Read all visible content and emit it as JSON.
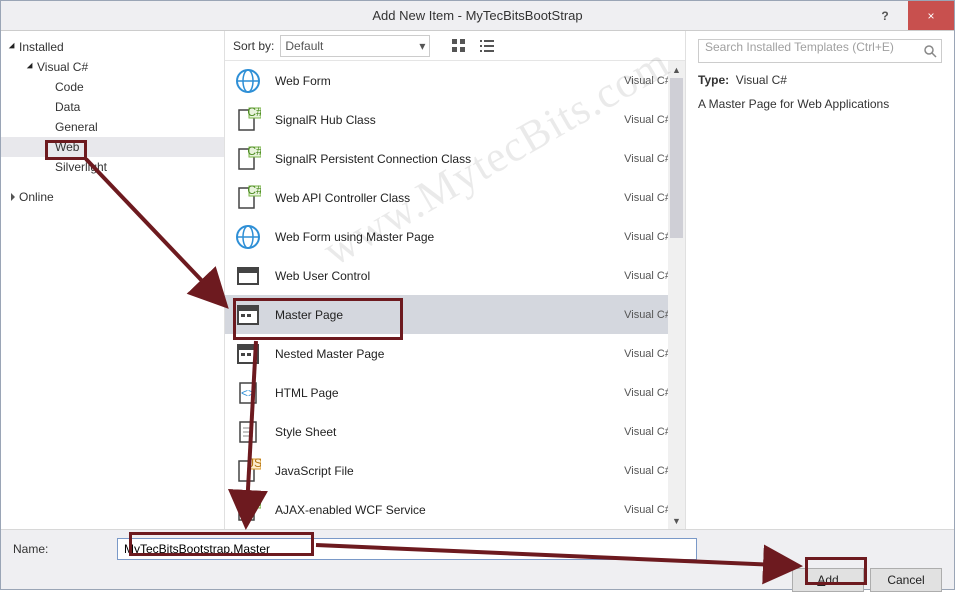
{
  "window": {
    "title": "Add New Item - MyTecBitsBootStrap",
    "help_tooltip": "?",
    "close_tooltip": "×"
  },
  "left": {
    "installed": "Installed",
    "visual_cs": "Visual C#",
    "items": {
      "code": "Code",
      "data": "Data",
      "general": "General",
      "web": "Web",
      "silverlight": "Silverlight"
    },
    "online": "Online"
  },
  "center": {
    "sortby_label": "Sort by:",
    "sortby_value": "Default",
    "rows": [
      {
        "label": "Web Form",
        "lang": "Visual C#",
        "icon": "globe"
      },
      {
        "label": "SignalR Hub Class",
        "lang": "Visual C#",
        "icon": "csfile"
      },
      {
        "label": "SignalR Persistent Connection Class",
        "lang": "Visual C#",
        "icon": "csfile"
      },
      {
        "label": "Web API Controller Class",
        "lang": "Visual C#",
        "icon": "csfile"
      },
      {
        "label": "Web Form using Master Page",
        "lang": "Visual C#",
        "icon": "globe"
      },
      {
        "label": "Web User Control",
        "lang": "Visual C#",
        "icon": "control"
      },
      {
        "label": "Master Page",
        "lang": "Visual C#",
        "icon": "master"
      },
      {
        "label": "Nested Master Page",
        "lang": "Visual C#",
        "icon": "master"
      },
      {
        "label": "HTML Page",
        "lang": "Visual C#",
        "icon": "html"
      },
      {
        "label": "Style Sheet",
        "lang": "Visual C#",
        "icon": "doc"
      },
      {
        "label": "JavaScript File",
        "lang": "Visual C#",
        "icon": "jsfile"
      },
      {
        "label": "AJAX-enabled WCF Service",
        "lang": "Visual C#",
        "icon": "csfile"
      }
    ]
  },
  "right": {
    "search_placeholder": "Search Installed Templates (Ctrl+E)",
    "type_label": "Type:",
    "type_value": "Visual C#",
    "description": "A Master Page for Web Applications"
  },
  "bottom": {
    "name_label": "Name:",
    "name_value": "MyTecBitsBootstrap.Master",
    "add_btn": "Add",
    "cancel_btn": "Cancel"
  },
  "watermark": "www.MytecBits.com"
}
